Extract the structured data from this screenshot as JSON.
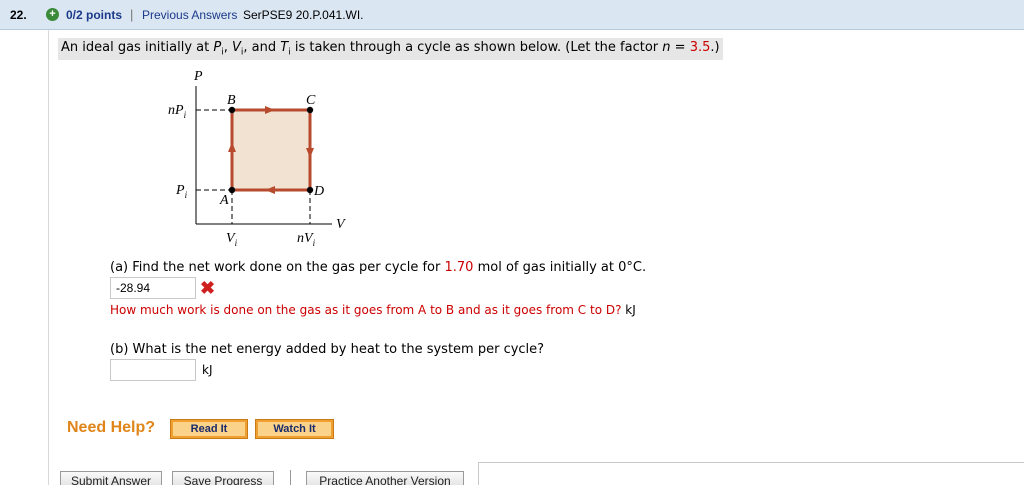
{
  "header": {
    "number": "22.",
    "points": "0/2 points",
    "separator": "|",
    "previous_answers": "Previous Answers",
    "problem_id": "SerPSE9 20.P.041.WI."
  },
  "problem": {
    "text_start": "An ideal gas initially at ",
    "p_label": "P",
    "v_label": "V",
    "t_label": "T",
    "sub_i": "i",
    "comma": ", ",
    "and": ", and ",
    "text_mid": " is taken through a cycle as shown below. (Let the factor ",
    "n_label": "n",
    "equals": " = ",
    "n_value": "3.5",
    "text_end": ".)"
  },
  "diagram": {
    "axis_p": "P",
    "axis_v": "V",
    "tick_nPi": "nP",
    "tick_Pi": "P",
    "tick_Vi": "V",
    "tick_nVi": "nV",
    "sub_i": "i",
    "point_a": "A",
    "point_b": "B",
    "point_c": "C",
    "point_d": "D",
    "fill_color": "#f1e2d1",
    "line_color": "#b84a2e"
  },
  "part_a": {
    "question_start": "(a) Find the net work done on the gas per cycle for ",
    "mol_value": "1.70",
    "question_end": " mol of gas initially at 0°C.",
    "answer_value": "-28.94",
    "status_icon": "x-icon",
    "hint_text": "How much work is done on the gas as it goes from A to B and as it goes from C to D?",
    "unit": "kJ"
  },
  "part_b": {
    "question": "(b) What is the net energy added by heat to the system per cycle?",
    "answer_value": "",
    "unit": "kJ"
  },
  "help": {
    "label": "Need Help?",
    "read_it": "Read It",
    "watch_it": "Watch It"
  },
  "actions": {
    "submit": "Submit Answer",
    "save": "Save Progress",
    "practice": "Practice Another Version"
  }
}
